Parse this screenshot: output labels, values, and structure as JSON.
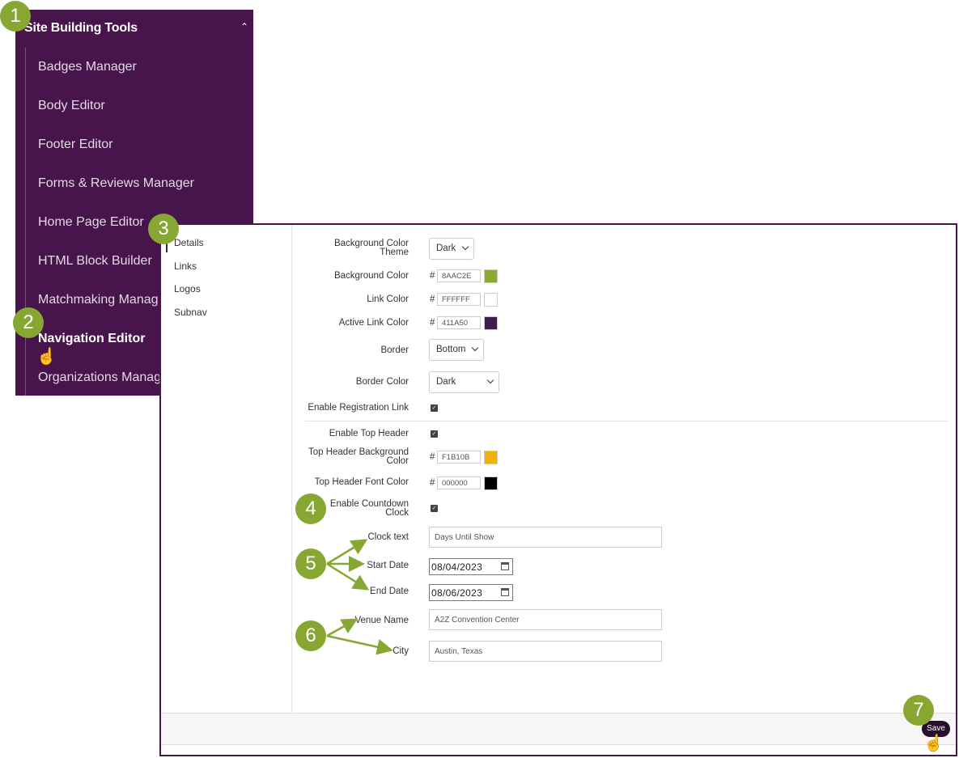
{
  "sidebar": {
    "header": "Site Building Tools",
    "items": [
      {
        "label": "Badges Manager"
      },
      {
        "label": "Body Editor"
      },
      {
        "label": "Footer Editor"
      },
      {
        "label": "Forms & Reviews Manager"
      },
      {
        "label": "Home Page Editor"
      },
      {
        "label": "HTML Block Builder"
      },
      {
        "label": "Matchmaking Manag"
      },
      {
        "label": "Navigation Editor"
      },
      {
        "label": "Organizations Manag"
      }
    ]
  },
  "tabs": [
    "Details",
    "Links",
    "Logos",
    "Subnav"
  ],
  "form": {
    "bg_theme": {
      "label_line1": "Background Color",
      "label_line2": "Theme",
      "value": "Dark"
    },
    "bg_color": {
      "label": "Background Color",
      "hash": "#",
      "value": "8AAC2E",
      "swatch": "#8aac2e"
    },
    "link_color": {
      "label": "Link Color",
      "hash": "#",
      "value": "FFFFFF",
      "swatch": "#ffffff"
    },
    "active_link_color": {
      "label": "Active Link Color",
      "hash": "#",
      "value": "411A50",
      "swatch": "#411a50"
    },
    "border": {
      "label": "Border",
      "value": "Bottom"
    },
    "border_color": {
      "label": "Border Color",
      "value": "Dark"
    },
    "enable_registration": {
      "label": "Enable Registration Link",
      "checked": true
    },
    "enable_top_header": {
      "label": "Enable Top Header",
      "checked": true
    },
    "top_header_bg": {
      "label_line1": "Top Header Background",
      "label_line2": "Color",
      "hash": "#",
      "value": "F1B10B",
      "swatch": "#f1b10b"
    },
    "top_header_font": {
      "label": "Top Header Font Color",
      "hash": "#",
      "value": "000000",
      "swatch": "#000000"
    },
    "enable_countdown": {
      "label_line1": "Enable Countdown",
      "label_line2": "Clock",
      "checked": true
    },
    "clock_text": {
      "label": "Clock text",
      "value": "Days Until Show"
    },
    "start_date": {
      "label": "Start Date",
      "value": "08/04/2023"
    },
    "end_date": {
      "label": "End Date",
      "value": "08/06/2023"
    },
    "venue_name": {
      "label": "Venue Name",
      "value": "A2Z Convention Center"
    },
    "city": {
      "label": "City",
      "value": "Austin, Texas"
    }
  },
  "footer": {
    "save_label": "Save"
  },
  "callouts": [
    "1",
    "2",
    "3",
    "4",
    "5",
    "6",
    "7"
  ],
  "colors": {
    "brand_purple": "#47154c",
    "callout_green": "#86a832"
  }
}
